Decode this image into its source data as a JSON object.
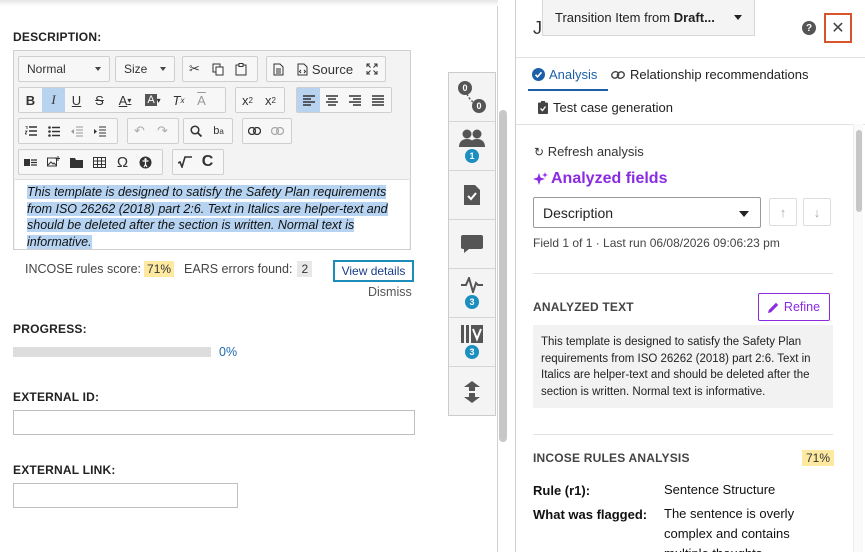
{
  "description": {
    "label": "DESCRIPTION:",
    "toolbar": {
      "format_select": "Normal",
      "size_select": "Size",
      "source_label": "Source"
    },
    "content": "This template is designed to satisfy the Safety Plan requirements from ISO 26262 (2018) part 2:6. Text in Italics are helper-text and should be deleted after the section is written. Normal text is informative.",
    "incose_label": "INCOSE rules score:",
    "incose_score": "71%",
    "ears_label": "EARS errors found:",
    "ears_count": "2",
    "view_details": "View details",
    "dismiss": "Dismiss"
  },
  "progress": {
    "label": "PROGRESS:",
    "value": 0,
    "text": "0%"
  },
  "external_id": {
    "label": "EXTERNAL ID:",
    "value": ""
  },
  "external_link": {
    "label": "EXTERNAL LINK:",
    "value": ""
  },
  "rail": {
    "relationships_count": "0",
    "relationships_count2": "0",
    "collaborators_badge": "1",
    "activity_badge": "3",
    "versions_badge": "3"
  },
  "panel": {
    "title_initial": "J",
    "transition_prefix": "Transition Item from ",
    "transition_bold": "Draft...",
    "help": "?",
    "close": "✕",
    "tabs": [
      {
        "label": "Analysis"
      },
      {
        "label": "Relationship recommendations"
      },
      {
        "label": "Test case generation"
      }
    ],
    "refresh": "Refresh analysis",
    "analyzed_fields": "Analyzed fields",
    "field_select": "Description",
    "field_info": "Field 1 of 1 · Last run 06/08/2026 09:06:23 pm",
    "analyzed_text_title": "ANALYZED TEXT",
    "refine": "Refine",
    "analyzed_text": "This template is designed to satisfy the Safety Plan requirements from ISO 26262 (2018) part 2:6. Text in Italics are helper-text and should be deleted after the section is written. Normal text is informative.",
    "incose_title": "INCOSE RULES ANALYSIS",
    "incose_pct": "71%",
    "rule_key": "Rule (r1):",
    "rule_value": "Sentence Structure",
    "flagged_key": "What was flagged:",
    "flagged_value": "The sentence is overly complex and contains multiple thoughts"
  },
  "colors": {
    "accent": "#1b5fa8",
    "purple": "#8a2be2",
    "close_border": "#d9532b",
    "badge": "#1a8fc0"
  }
}
